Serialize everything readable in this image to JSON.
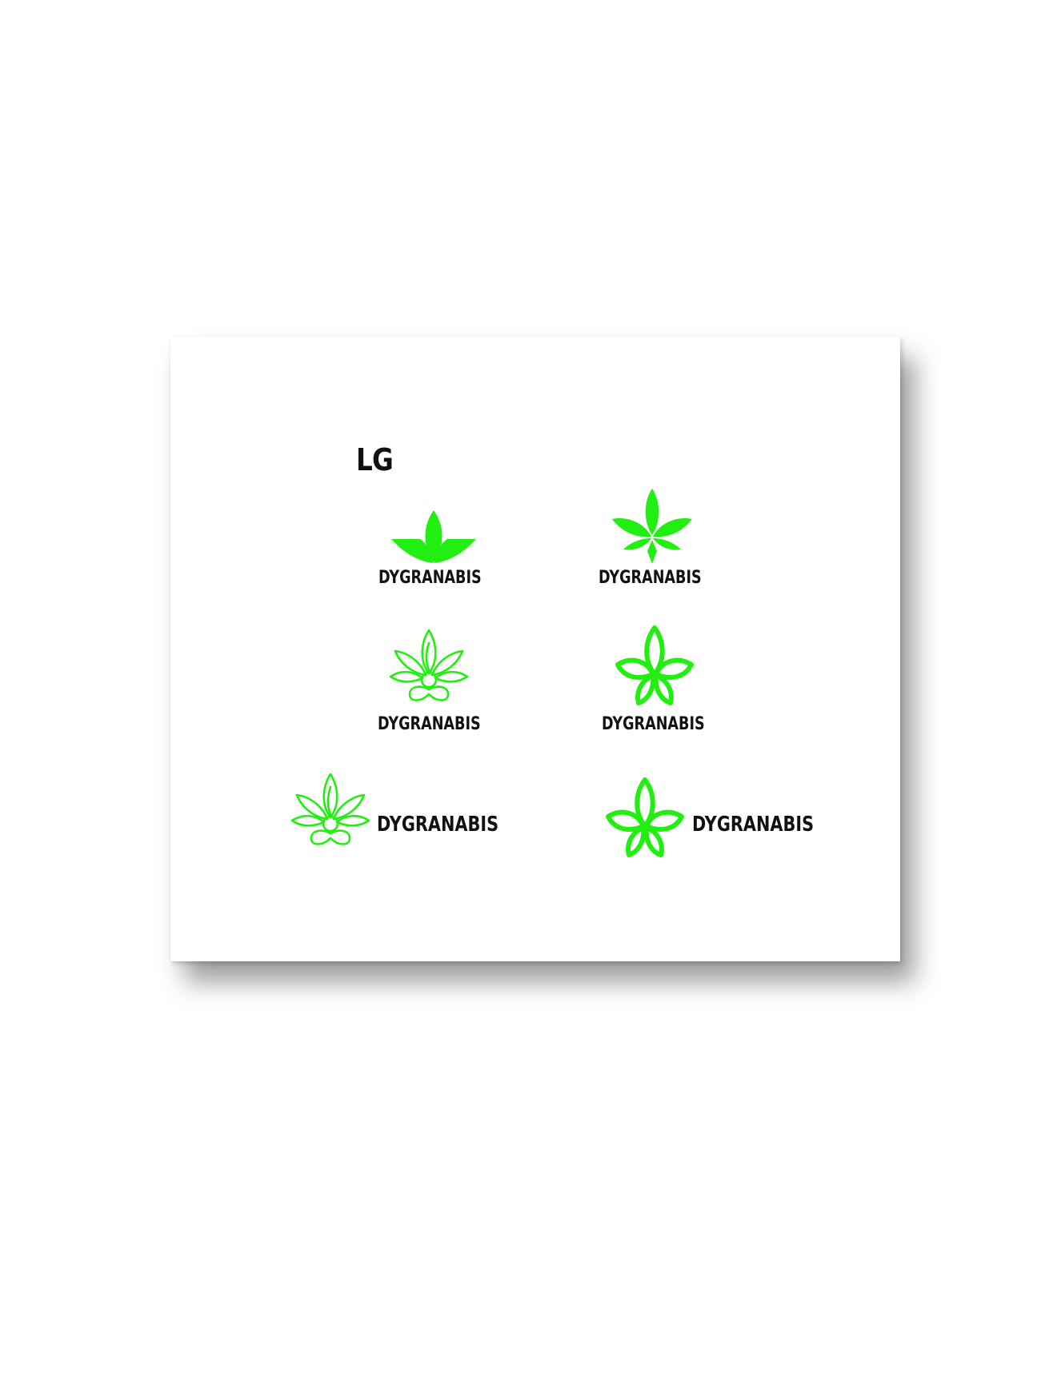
{
  "section_title": "LG",
  "brand_color": "#22ee11",
  "text_color": "#111111",
  "logos": [
    {
      "variant": "solid-three-leaf",
      "wordmark": "DYGRANABIS"
    },
    {
      "variant": "solid-five-leaf",
      "wordmark": "DYGRANABIS"
    },
    {
      "variant": "outline-leaf-lotus",
      "wordmark": "DYGRANABIS"
    },
    {
      "variant": "outline-knot-leaf",
      "wordmark": "DYGRANABIS"
    },
    {
      "variant": "outline-leaf-lotus-horizontal",
      "wordmark": "DYGRANABIS"
    },
    {
      "variant": "outline-knot-leaf-horizontal",
      "wordmark": "DYGRANABIS"
    }
  ]
}
